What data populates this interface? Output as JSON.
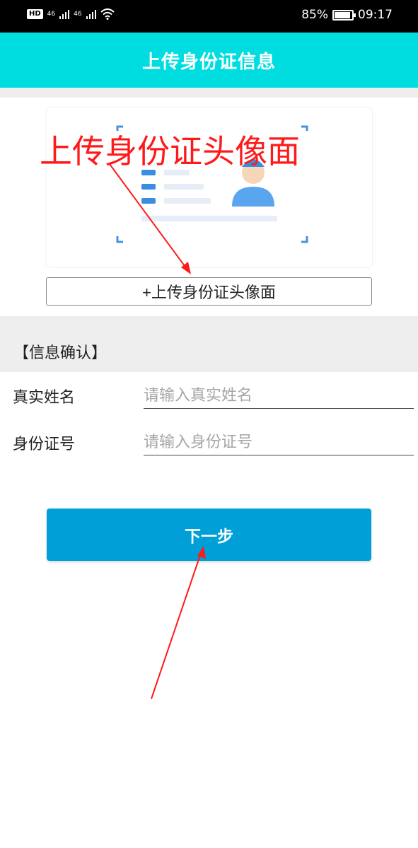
{
  "status_bar": {
    "hd": "HD",
    "sim1": "46",
    "sim2": "46",
    "battery_pct": "85%",
    "time": "09:17"
  },
  "header": {
    "title": "上传身份证信息"
  },
  "upload": {
    "button_label": "+上传身份证头像面",
    "annotation": "上传身份证头像面"
  },
  "confirm": {
    "section_title": "【信息确认】",
    "fields": [
      {
        "label": "真实姓名",
        "placeholder": "请输入真实姓名"
      },
      {
        "label": "身份证号",
        "placeholder": "请输入身份证号"
      }
    ]
  },
  "next_button": {
    "label": "下一步"
  },
  "colors": {
    "header_bg": "#00dde0",
    "button_bg": "#009fd8",
    "annotation": "#ff1a1a",
    "card_icon_blue": "#4a90e2"
  },
  "icons": [
    "wifi-icon",
    "battery-icon",
    "signal-icon",
    "id-card-illustration"
  ]
}
